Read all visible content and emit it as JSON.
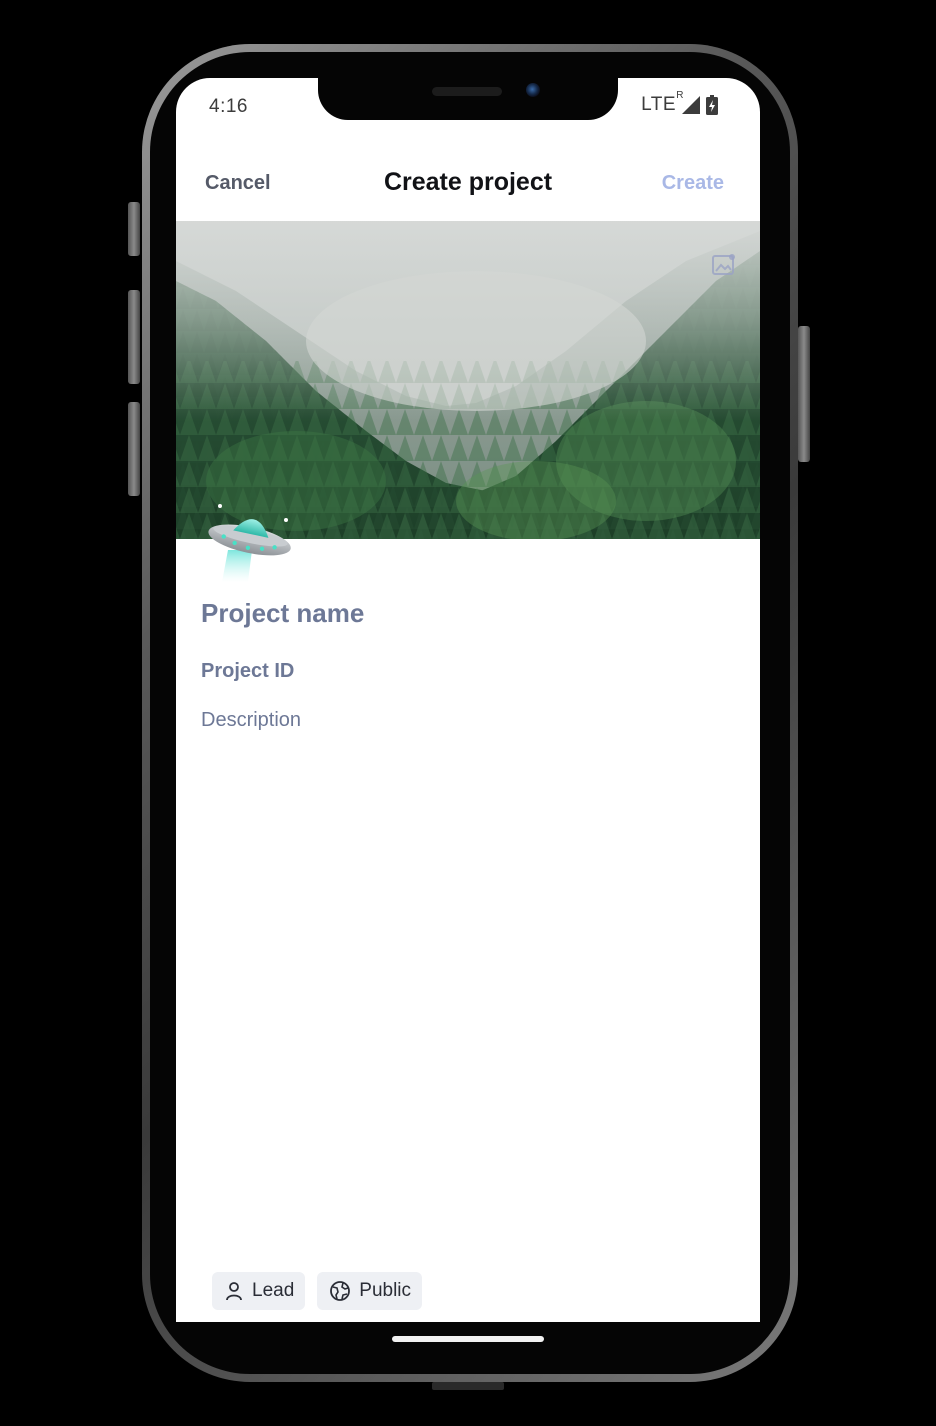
{
  "status_bar": {
    "time": "4:16",
    "network": "LTE",
    "roaming": "R"
  },
  "header": {
    "cancel_label": "Cancel",
    "title": "Create project",
    "create_label": "Create"
  },
  "form": {
    "name_placeholder": "Project name",
    "id_placeholder": "Project ID",
    "description_placeholder": "Description"
  },
  "chips": [
    {
      "label": "Lead",
      "icon": "person-icon"
    },
    {
      "label": "Public",
      "icon": "globe-icon"
    }
  ],
  "colors": {
    "create_disabled": "#a9b8e6",
    "placeholder": "#6d7896",
    "chip_bg": "#eef0f4"
  }
}
